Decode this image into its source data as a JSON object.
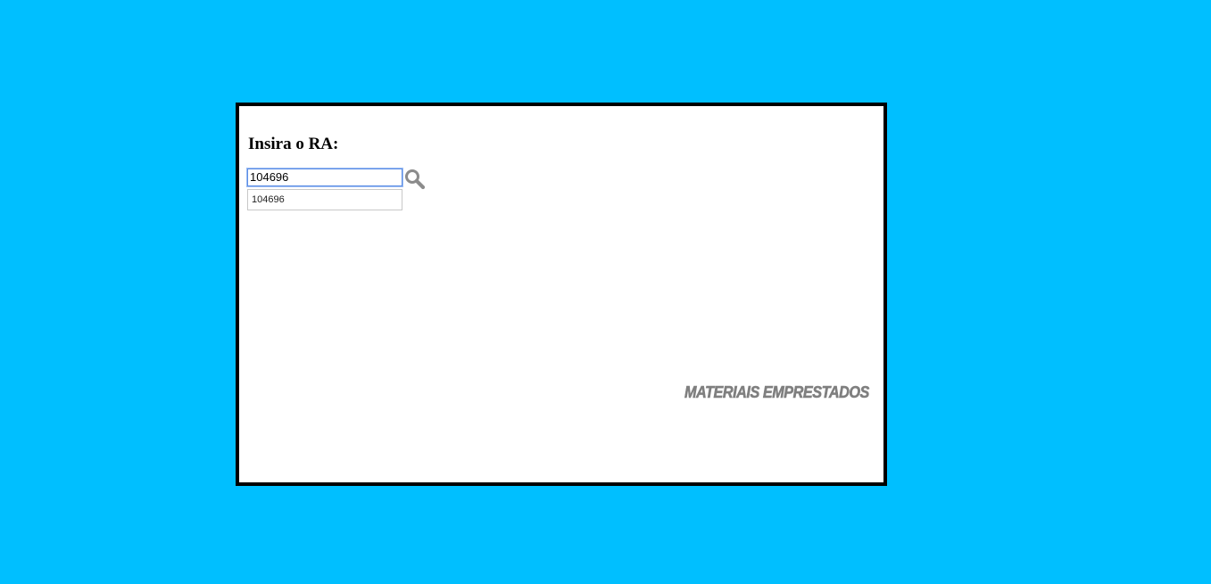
{
  "form": {
    "label": "Insira o RA:",
    "ra_value": "104696",
    "search_icon": "search-icon"
  },
  "autocomplete": {
    "items": [
      "104696"
    ]
  },
  "footer": {
    "link_label": "MATERIAIS EMPRESTADOS"
  },
  "colors": {
    "background": "#00bfff",
    "panel": "#ffffff",
    "panel_border": "#000000",
    "link": "#7f7f7f",
    "icon": "#8c8c8c"
  }
}
